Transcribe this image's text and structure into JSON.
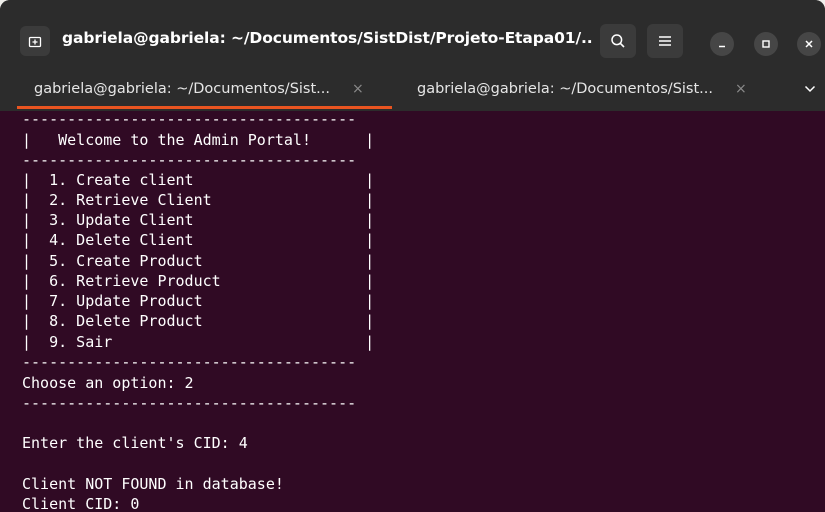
{
  "window": {
    "title": "gabriela@gabriela: ~/Documentos/SistDist/Projeto-Etapa01/..."
  },
  "tabs": [
    {
      "label": "gabriela@gabriela: ~/Documentos/Sist...",
      "active": true
    },
    {
      "label": "gabriela@gabriela: ~/Documentos/Sist...",
      "active": false
    }
  ],
  "icons": {
    "new_tab": "new-tab-icon",
    "search": "search-icon",
    "menu": "hamburger-menu-icon",
    "minimize": "minimize-icon",
    "maximize": "maximize-icon",
    "close": "close-icon",
    "tab_close": "×",
    "tabs_dropdown": "chevron-down-icon"
  },
  "colors": {
    "terminal_bg": "#300a24",
    "headerbar_bg": "#2c2c2c",
    "active_tab_accent": "#e95420",
    "text": "#ffffff"
  },
  "terminal": {
    "lines": [
      "-------------------------------------",
      "|   Welcome to the Admin Portal!      |",
      "-------------------------------------",
      "|  1. Create client                   |",
      "|  2. Retrieve Client                 |",
      "|  3. Update Client                   |",
      "|  4. Delete Client                   |",
      "|  5. Create Product                  |",
      "|  6. Retrieve Product                |",
      "|  7. Update Product                  |",
      "|  8. Delete Product                  |",
      "|  9. Sair                            |",
      "-------------------------------------",
      "Choose an option: 2",
      "-------------------------------------",
      "",
      "Enter the client's CID: 4",
      "",
      "Client NOT FOUND in database!",
      "Client CID: 0"
    ]
  }
}
